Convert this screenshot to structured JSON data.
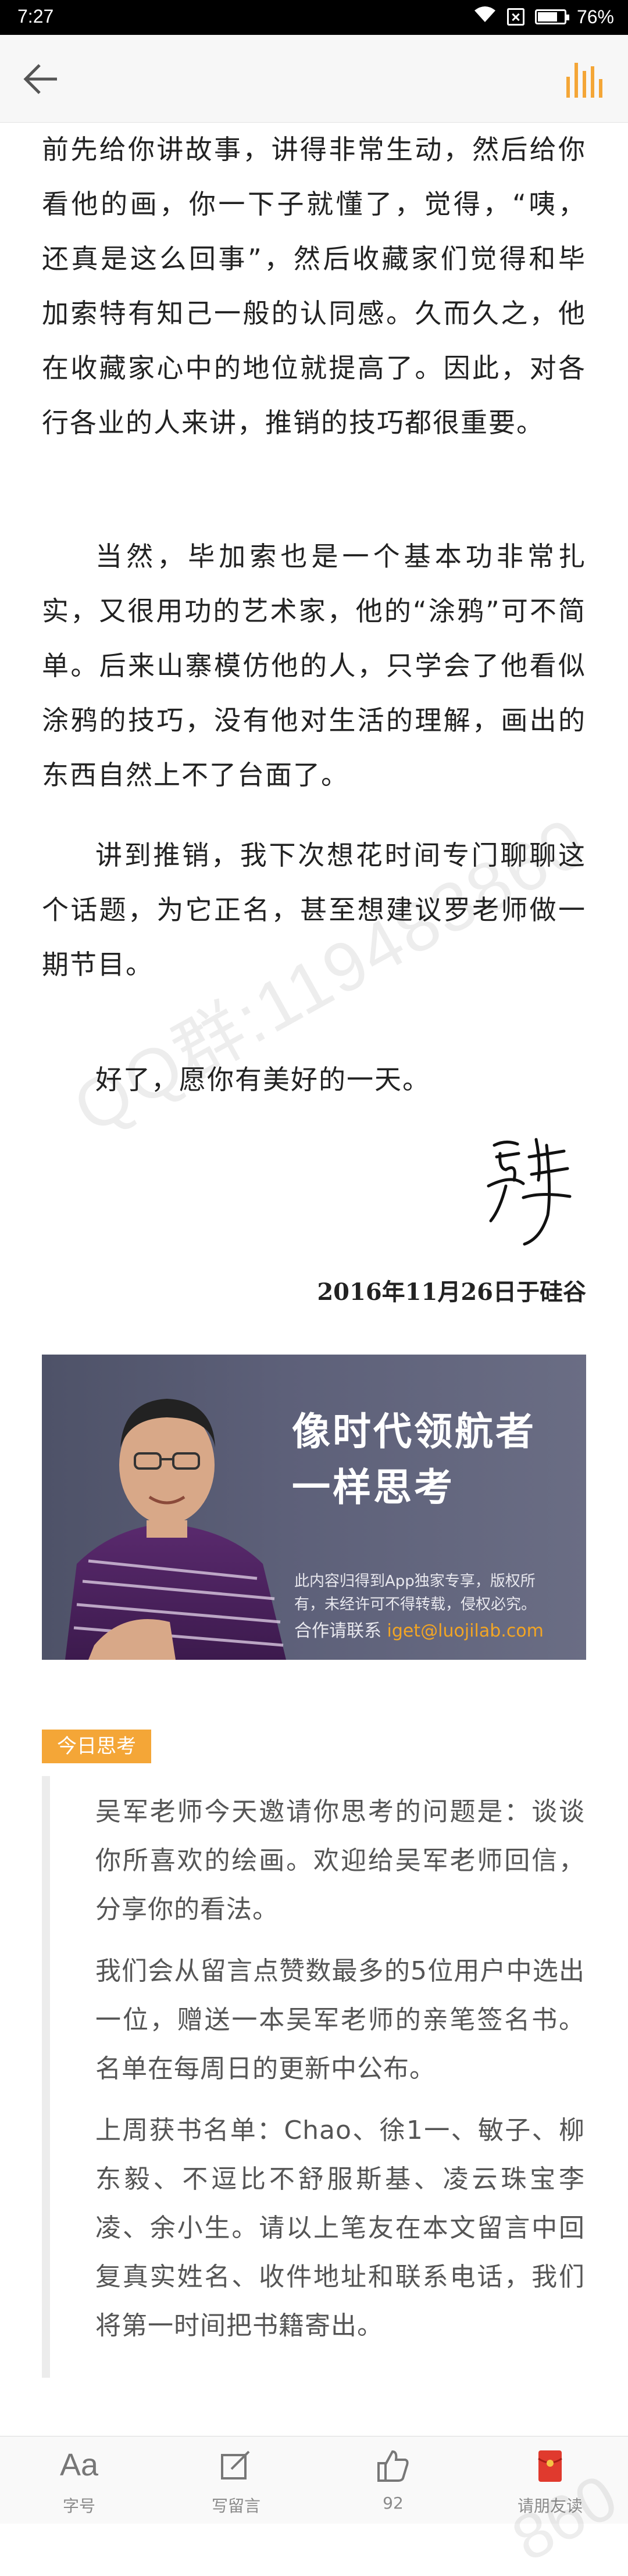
{
  "status_bar": {
    "time": "7:27",
    "battery_text": "76%",
    "battery_level": 0.76
  },
  "nav": {
    "back_icon": "arrow-left-icon",
    "audio_icon": "audio-bars-icon",
    "accent_color": "#f4a637"
  },
  "article": {
    "paragraphs": [
      "前先给你讲故事，讲得非常生动，然后给你看他的画，你一下子就懂了，觉得，“咦，还真是这么回事”，然后收藏家们觉得和毕加索特有知己一般的认同感。久而久之，他在收藏家心中的地位就提高了。因此，对各行各业的人来讲，推销的技巧都很重要。",
      "当然，毕加索也是一个基本功非常扎实，又很用功的艺术家，他的“涂鸦”可不简单。后来山寨模仿他的人，只学会了他看似涂鸦的技巧，没有他对生活的理解，画出的东西自然上不了台面了。",
      "讲到推销，我下次想花时间专门聊聊这个话题，为它正名，甚至想建议罗老师做一期节目。",
      "好了，愿你有美好的一天。"
    ],
    "signature_text": "吴军",
    "date_line": "2016年11月26日于硅谷"
  },
  "banner": {
    "headline_line1": "像时代领航者",
    "headline_line2": "一样思考",
    "copyright_line1": "此内容归得到App独家专享，版权所",
    "copyright_line2": "有，未经许可不得转载，侵权必究。",
    "contact_label": "合作请联系",
    "contact_email": "iget@luojilab.com"
  },
  "today_thinking": {
    "tag": "今日思考",
    "paragraphs": [
      "吴军老师今天邀请你思考的问题是：谈谈你所喜欢的绘画。欢迎给吴军老师回信，分享你的看法。",
      "我们会从留言点赞数最多的5位用户中选出一位，赠送一本吴军老师的亲笔签名书。名单在每周日的更新中公布。",
      "上周获书名单：Chao、徐1一、敏子、柳东毅、不逗比不舒服斯基、凌云珠宝李凌、余小生。请以上笔友在本文留言中回复真实姓名、收件地址和联系电话，我们将第一时间把书籍寄出。"
    ]
  },
  "watermark": "QQ群:119483860",
  "watermark_tail": "860",
  "toolbar": {
    "font_glyph": "Aa",
    "font_label": "字号",
    "comment_label": "写留言",
    "like_count": "92",
    "share_label": "请朋友读"
  }
}
